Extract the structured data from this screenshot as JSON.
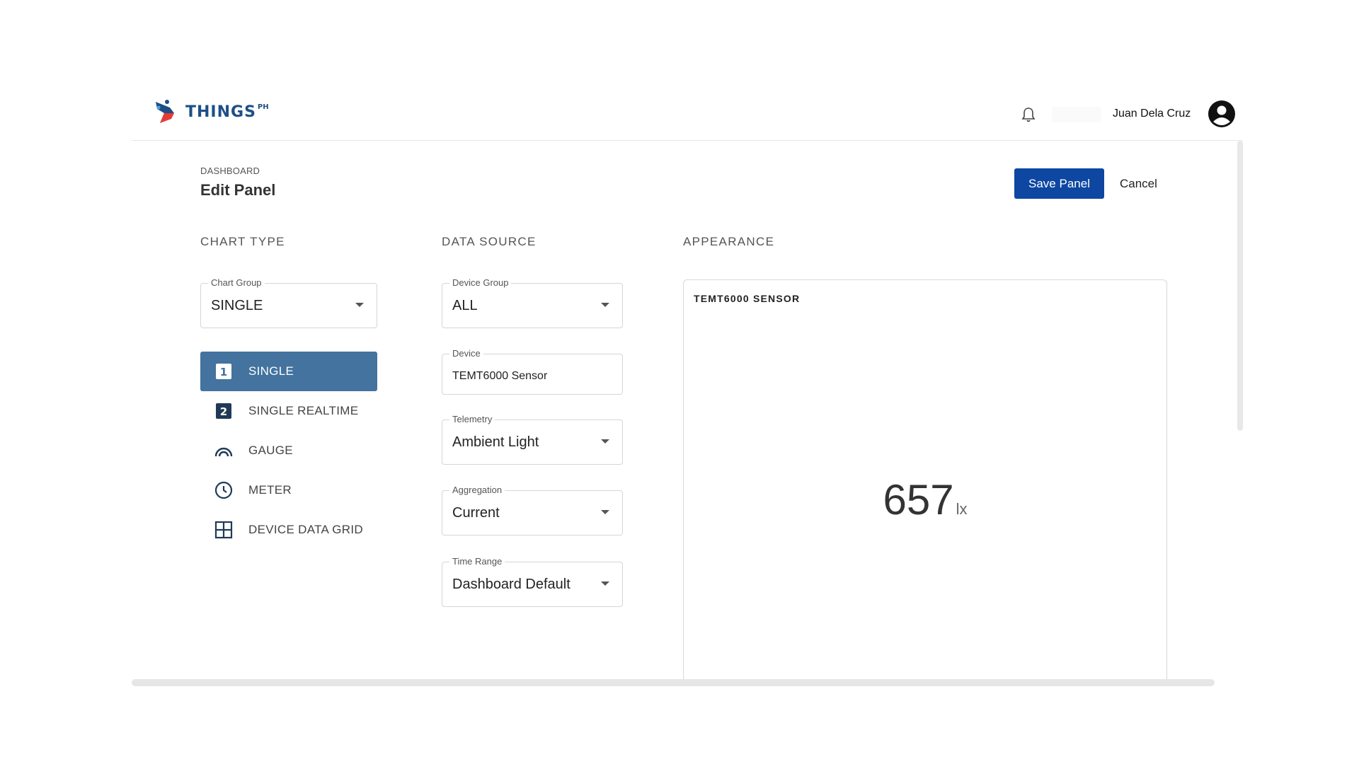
{
  "brand": {
    "name": "THINGS",
    "suffix": "PH"
  },
  "header": {
    "user_name": "Juan Dela Cruz",
    "notifications_icon": "bell-icon",
    "avatar_icon": "account-circle-icon"
  },
  "breadcrumb": "DASHBOARD",
  "title": "Edit Panel",
  "actions": {
    "save": "Save Panel",
    "cancel": "Cancel"
  },
  "colors": {
    "primary": "#0d47a1",
    "active_item": "#43739e",
    "logo_blue": "#1d4f86",
    "logo_red": "#e53935"
  },
  "sections": {
    "chart_type": "CHART TYPE",
    "data_source": "DATA SOURCE",
    "appearance": "APPEARANCE"
  },
  "chart_group": {
    "label": "Chart Group",
    "value": "SINGLE"
  },
  "chart_types": [
    {
      "label": "SINGLE",
      "icon": "number-one-box-icon",
      "active": true
    },
    {
      "label": "SINGLE REALTIME",
      "icon": "number-two-box-icon",
      "active": false
    },
    {
      "label": "GAUGE",
      "icon": "gauge-icon",
      "active": false
    },
    {
      "label": "METER",
      "icon": "clock-icon",
      "active": false
    },
    {
      "label": "DEVICE DATA GRID",
      "icon": "grid-icon",
      "active": false
    }
  ],
  "data_source": {
    "device_group": {
      "label": "Device Group",
      "value": "ALL"
    },
    "device": {
      "label": "Device",
      "value": "TEMT6000 Sensor"
    },
    "telemetry": {
      "label": "Telemetry",
      "value": "Ambient Light"
    },
    "aggregation": {
      "label": "Aggregation",
      "value": "Current"
    },
    "time_range": {
      "label": "Time Range",
      "value": "Dashboard Default"
    }
  },
  "preview": {
    "title": "TEMT6000 SENSOR",
    "value": "657",
    "unit": "lx"
  }
}
